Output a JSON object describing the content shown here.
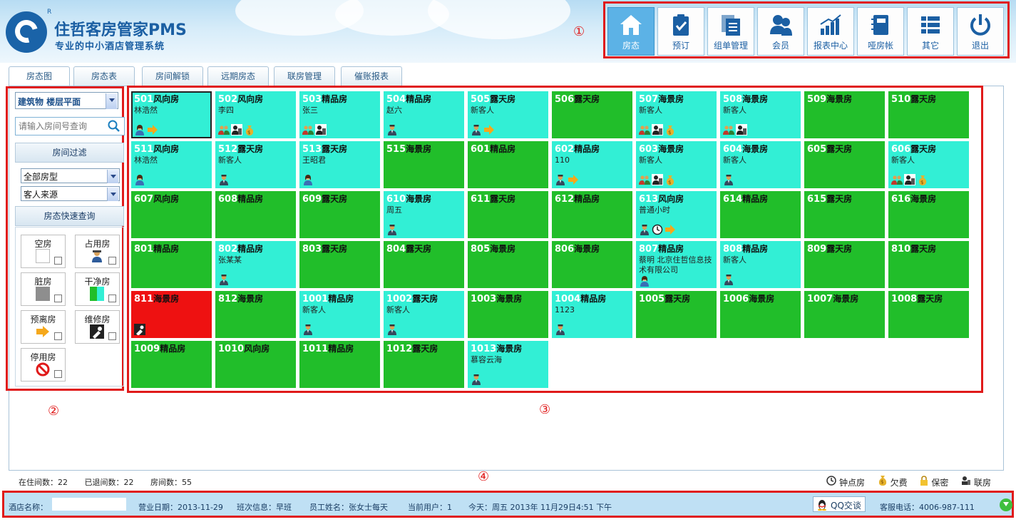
{
  "brand": {
    "title": "住哲客房管家PMS",
    "subtitle": "专业的中小酒店管理系统",
    "reg": "R"
  },
  "toolbar": [
    {
      "label": "房态",
      "icon": "home-icon",
      "active": true
    },
    {
      "label": "预订",
      "icon": "clipboard-check-icon"
    },
    {
      "label": "组单管理",
      "icon": "documents-icon"
    },
    {
      "label": "会员",
      "icon": "users-icon"
    },
    {
      "label": "报表中心",
      "icon": "bar-chart-icon"
    },
    {
      "label": "哑房帐",
      "icon": "notebook-icon"
    },
    {
      "label": "其它",
      "icon": "list-icon"
    },
    {
      "label": "退出",
      "icon": "power-icon"
    }
  ],
  "markers": {
    "m1": "①",
    "m2": "②",
    "m3": "③",
    "m4": "④"
  },
  "tabs": [
    "房态图",
    "房态表",
    "房间解锁",
    "远期房态",
    "联房管理",
    "催账报表"
  ],
  "left": {
    "building_select": "建筑物 楼层平面",
    "search_placeholder": "请输入房间号查询",
    "filter_head": "房间过滤",
    "room_type": "全部房型",
    "guest_source": "客人来源",
    "quick_head": "房态快速查询",
    "legend": [
      {
        "label": "空房",
        "swatch": "white"
      },
      {
        "label": "占用房",
        "swatch": "person-icon"
      },
      {
        "label": "脏房",
        "swatch": "gray"
      },
      {
        "label": "干净房",
        "swatch": "clean"
      },
      {
        "label": "预离房",
        "swatch": "arrow-icon"
      },
      {
        "label": "维修房",
        "swatch": "repair-icon"
      },
      {
        "label": "停用房",
        "swatch": "forbidden-icon"
      }
    ]
  },
  "rooms": [
    {
      "no": "501",
      "type": "风向房",
      "guest": "林浩然",
      "status": "occ",
      "selected": true,
      "icons": [
        "female",
        "arrow"
      ]
    },
    {
      "no": "502",
      "type": "风向房",
      "guest": "李四",
      "status": "occ",
      "icons": [
        "group",
        "link",
        "money"
      ]
    },
    {
      "no": "503",
      "type": "精品房",
      "guest": "张三",
      "status": "occ",
      "icons": [
        "group",
        "link"
      ]
    },
    {
      "no": "504",
      "type": "精品房",
      "guest": "赵六",
      "status": "occ",
      "icons": [
        "male"
      ]
    },
    {
      "no": "505",
      "type": "露天房",
      "guest": "新客人",
      "status": "occ",
      "icons": [
        "male",
        "arrow"
      ]
    },
    {
      "no": "506",
      "type": "露天房",
      "guest": "",
      "status": "empty",
      "icons": []
    },
    {
      "no": "507",
      "type": "海景房",
      "guest": "新客人",
      "status": "occ",
      "icons": [
        "group",
        "link",
        "money"
      ]
    },
    {
      "no": "508",
      "type": "海景房",
      "guest": "新客人",
      "status": "occ",
      "icons": [
        "group",
        "link"
      ]
    },
    {
      "no": "509",
      "type": "海景房",
      "guest": "",
      "status": "empty",
      "icons": []
    },
    {
      "no": "510",
      "type": "露天房",
      "guest": "",
      "status": "empty",
      "icons": []
    },
    {
      "no": "511",
      "type": "风向房",
      "guest": "林浩然",
      "status": "occ",
      "icons": [
        "female"
      ]
    },
    {
      "no": "512",
      "type": "露天房",
      "guest": "新客人",
      "status": "occ",
      "icons": [
        "male"
      ]
    },
    {
      "no": "513",
      "type": "露天房",
      "guest": "王昭君",
      "status": "occ",
      "icons": [
        "female"
      ]
    },
    {
      "no": "515",
      "type": "海景房",
      "guest": "",
      "status": "empty",
      "icons": []
    },
    {
      "no": "601",
      "type": "精品房",
      "guest": "",
      "status": "empty",
      "icons": []
    },
    {
      "no": "602",
      "type": "精品房",
      "guest": "110",
      "status": "occ",
      "icons": [
        "male",
        "arrow"
      ]
    },
    {
      "no": "603",
      "type": "海景房",
      "guest": "新客人",
      "status": "occ",
      "icons": [
        "group",
        "link",
        "money"
      ]
    },
    {
      "no": "604",
      "type": "海景房",
      "guest": "新客人",
      "status": "occ",
      "icons": [
        "male"
      ]
    },
    {
      "no": "605",
      "type": "露天房",
      "guest": "",
      "status": "empty",
      "icons": []
    },
    {
      "no": "606",
      "type": "露天房",
      "guest": "新客人",
      "status": "occ",
      "icons": [
        "group",
        "link",
        "money"
      ]
    },
    {
      "no": "607",
      "type": "风向房",
      "guest": "",
      "status": "empty",
      "icons": []
    },
    {
      "no": "608",
      "type": "精品房",
      "guest": "",
      "status": "empty",
      "icons": []
    },
    {
      "no": "609",
      "type": "露天房",
      "guest": "",
      "status": "empty",
      "icons": []
    },
    {
      "no": "610",
      "type": "海景房",
      "guest": "周五",
      "status": "occ",
      "icons": [
        "male"
      ]
    },
    {
      "no": "611",
      "type": "露天房",
      "guest": "",
      "status": "empty",
      "icons": []
    },
    {
      "no": "612",
      "type": "精品房",
      "guest": "",
      "status": "empty",
      "icons": []
    },
    {
      "no": "613",
      "type": "风向房",
      "guest": "普通小时",
      "status": "occ",
      "icons": [
        "male",
        "clock",
        "arrow"
      ]
    },
    {
      "no": "614",
      "type": "精品房",
      "guest": "",
      "status": "empty",
      "icons": []
    },
    {
      "no": "615",
      "type": "露天房",
      "guest": "",
      "status": "empty",
      "icons": []
    },
    {
      "no": "616",
      "type": "海景房",
      "guest": "",
      "status": "empty",
      "icons": []
    },
    {
      "no": "801",
      "type": "精品房",
      "guest": "",
      "status": "empty",
      "icons": []
    },
    {
      "no": "802",
      "type": "精品房",
      "guest": "张某某",
      "status": "occ",
      "icons": [
        "male"
      ]
    },
    {
      "no": "803",
      "type": "露天房",
      "guest": "",
      "status": "empty",
      "icons": []
    },
    {
      "no": "804",
      "type": "露天房",
      "guest": "",
      "status": "empty",
      "icons": []
    },
    {
      "no": "805",
      "type": "海景房",
      "guest": "",
      "status": "empty",
      "icons": []
    },
    {
      "no": "806",
      "type": "海景房",
      "guest": "",
      "status": "empty",
      "icons": []
    },
    {
      "no": "807",
      "type": "精品房",
      "guest": "蔡明 北京住哲信息技术有限公司",
      "status": "occ",
      "wrap": true,
      "icons": [
        "female"
      ]
    },
    {
      "no": "808",
      "type": "精品房",
      "guest": "新客人",
      "status": "occ",
      "icons": [
        "male"
      ]
    },
    {
      "no": "809",
      "type": "露天房",
      "guest": "",
      "status": "empty",
      "icons": []
    },
    {
      "no": "810",
      "type": "露天房",
      "guest": "",
      "status": "empty",
      "icons": []
    },
    {
      "no": "811",
      "type": "海景房",
      "guest": "",
      "status": "dirty",
      "icons": [
        "repair"
      ]
    },
    {
      "no": "812",
      "type": "海景房",
      "guest": "",
      "status": "empty",
      "icons": []
    },
    {
      "no": "1001",
      "type": "精品房",
      "guest": "新客人",
      "status": "occ",
      "icons": [
        "male"
      ]
    },
    {
      "no": "1002",
      "type": "露天房",
      "guest": "新客人",
      "status": "occ",
      "icons": [
        "male"
      ]
    },
    {
      "no": "1003",
      "type": "海景房",
      "guest": "",
      "status": "empty",
      "icons": []
    },
    {
      "no": "1004",
      "type": "精品房",
      "guest": "1123",
      "status": "occ",
      "icons": [
        "male"
      ]
    },
    {
      "no": "1005",
      "type": "露天房",
      "guest": "",
      "status": "empty",
      "icons": []
    },
    {
      "no": "1006",
      "type": "海景房",
      "guest": "",
      "status": "empty",
      "icons": []
    },
    {
      "no": "1007",
      "type": "海景房",
      "guest": "",
      "status": "empty",
      "icons": []
    },
    {
      "no": "1008",
      "type": "露天房",
      "guest": "",
      "status": "empty",
      "icons": []
    },
    {
      "no": "1009",
      "type": "精品房",
      "guest": "",
      "status": "empty",
      "icons": []
    },
    {
      "no": "1010",
      "type": "风向房",
      "guest": "",
      "status": "empty",
      "icons": []
    },
    {
      "no": "1011",
      "type": "精品房",
      "guest": "",
      "status": "empty",
      "icons": []
    },
    {
      "no": "1012",
      "type": "露天房",
      "guest": "",
      "status": "empty",
      "icons": []
    },
    {
      "no": "1013",
      "type": "海景房",
      "guest": "慕容云海",
      "status": "occ",
      "icons": [
        "male"
      ]
    }
  ],
  "stats": {
    "occupied": "在住间数：22",
    "checked_out": "已退间数：22",
    "total": "房间数：55"
  },
  "legend_row": [
    {
      "icon": "clock-icon",
      "label": "钟点房"
    },
    {
      "icon": "money-bag-icon",
      "label": "欠费"
    },
    {
      "icon": "lock-icon",
      "label": "保密"
    },
    {
      "icon": "link-rooms-icon",
      "label": "联房"
    }
  ],
  "footer": {
    "hotel_label": "酒店名称：",
    "business_date": "营业日期：2013-11-29",
    "shift": "班次信息：早班",
    "staff": "员工姓名：张女士每天",
    "current_users": "当前用户：1",
    "today": "今天：周五  2013年 11月29日4:51 下午",
    "qq": "QQ交谈",
    "phone": "客服电话：4006-987-111"
  },
  "colors": {
    "empty": "#21be2a",
    "occ": "#32efd5",
    "dirty": "#ee1111",
    "accent": "#1b5fa3",
    "highlight": "#e01a1a"
  }
}
